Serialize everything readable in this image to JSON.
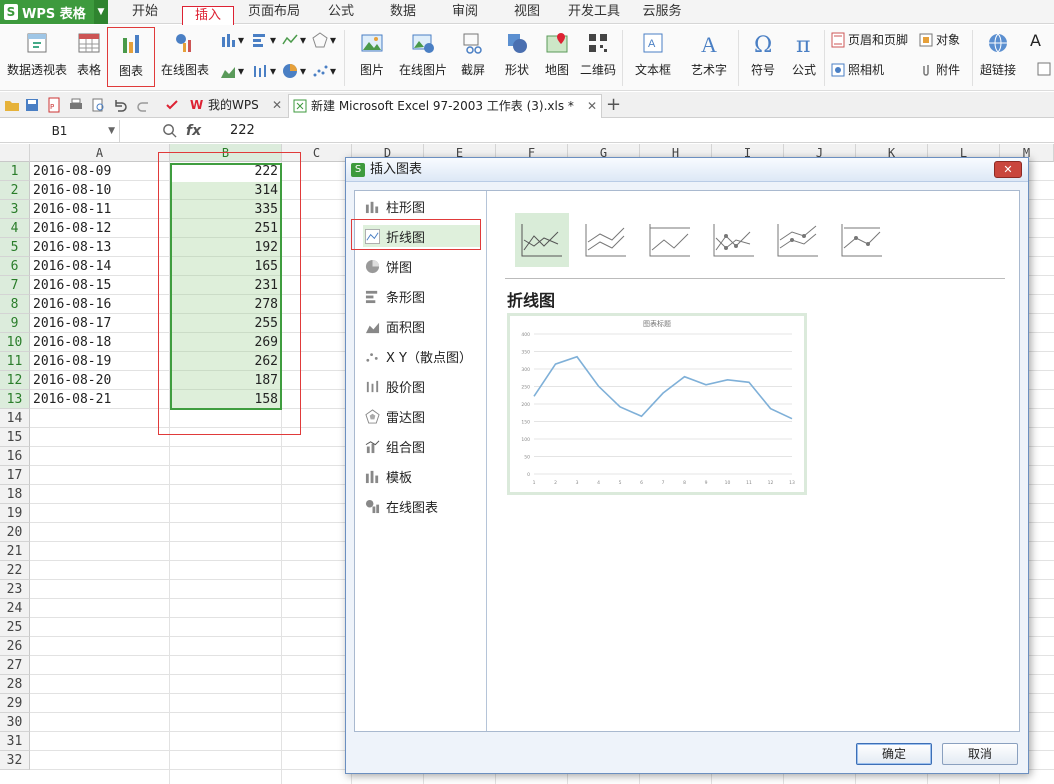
{
  "app": {
    "name": "WPS 表格",
    "logo": "S"
  },
  "menu_tabs": [
    "开始",
    "插入",
    "页面布局",
    "公式",
    "数据",
    "审阅",
    "视图",
    "开发工具",
    "云服务"
  ],
  "active_tab": "插入",
  "ribbon": {
    "pivot": "数据透视表",
    "table": "表格",
    "chart": "图表",
    "online_chart": "在线图表",
    "picture": "图片",
    "online_picture": "在线图片",
    "screenshot": "截屏",
    "shape": "形状",
    "map": "地图",
    "qrcode": "二维码",
    "textbox": "文本框",
    "wordart": "艺术字",
    "symbol": "符号",
    "formula": "公式",
    "header_footer": "页眉和页脚",
    "object": "对象",
    "camera": "照相机",
    "attachment": "附件",
    "hyperlink": "超链接"
  },
  "doc_tabs": {
    "mywps": "我的WPS",
    "file": "新建 Microsoft Excel 97-2003 工作表 (3).xls *"
  },
  "formula_bar": {
    "cell_ref": "B1",
    "fx": "fx",
    "value": "222"
  },
  "columns": [
    "A",
    "B",
    "C",
    "D",
    "E",
    "F",
    "G",
    "H",
    "I",
    "J",
    "K",
    "L",
    "M"
  ],
  "rows": [
    "1",
    "2",
    "3",
    "4",
    "5",
    "6",
    "7",
    "8",
    "9",
    "10",
    "11",
    "12",
    "13",
    "14",
    "15",
    "16",
    "17",
    "18",
    "19",
    "20",
    "21",
    "22",
    "23",
    "24",
    "25",
    "26",
    "27",
    "28",
    "29",
    "30",
    "31",
    "32"
  ],
  "sheet_data": [
    [
      "2016-08-09",
      "222"
    ],
    [
      "2016-08-10",
      "314"
    ],
    [
      "2016-08-11",
      "335"
    ],
    [
      "2016-08-12",
      "251"
    ],
    [
      "2016-08-13",
      "192"
    ],
    [
      "2016-08-14",
      "165"
    ],
    [
      "2016-08-15",
      "231"
    ],
    [
      "2016-08-16",
      "278"
    ],
    [
      "2016-08-17",
      "255"
    ],
    [
      "2016-08-18",
      "269"
    ],
    [
      "2016-08-19",
      "262"
    ],
    [
      "2016-08-20",
      "187"
    ],
    [
      "2016-08-21",
      "158"
    ]
  ],
  "dialog": {
    "title": "插入图表",
    "chart_types": [
      "柱形图",
      "折线图",
      "饼图",
      "条形图",
      "面积图",
      "X Y（散点图）",
      "股价图",
      "雷达图",
      "组合图",
      "模板",
      "在线图表"
    ],
    "selected_type": "折线图",
    "preview_heading": "折线图",
    "preview_chart_title": "图表标题",
    "preview_y_ticks": [
      "0",
      "50",
      "100",
      "150",
      "200",
      "250",
      "300",
      "350",
      "400"
    ],
    "preview_x_ticks": [
      "1",
      "2",
      "3",
      "4",
      "5",
      "6",
      "7",
      "8",
      "9",
      "10",
      "11",
      "12",
      "13"
    ],
    "ok": "确定",
    "cancel": "取消"
  },
  "colors": {
    "accent": "#3d9a3d",
    "highlight_red": "#e03a3a",
    "line": "#7fb0d8"
  }
}
